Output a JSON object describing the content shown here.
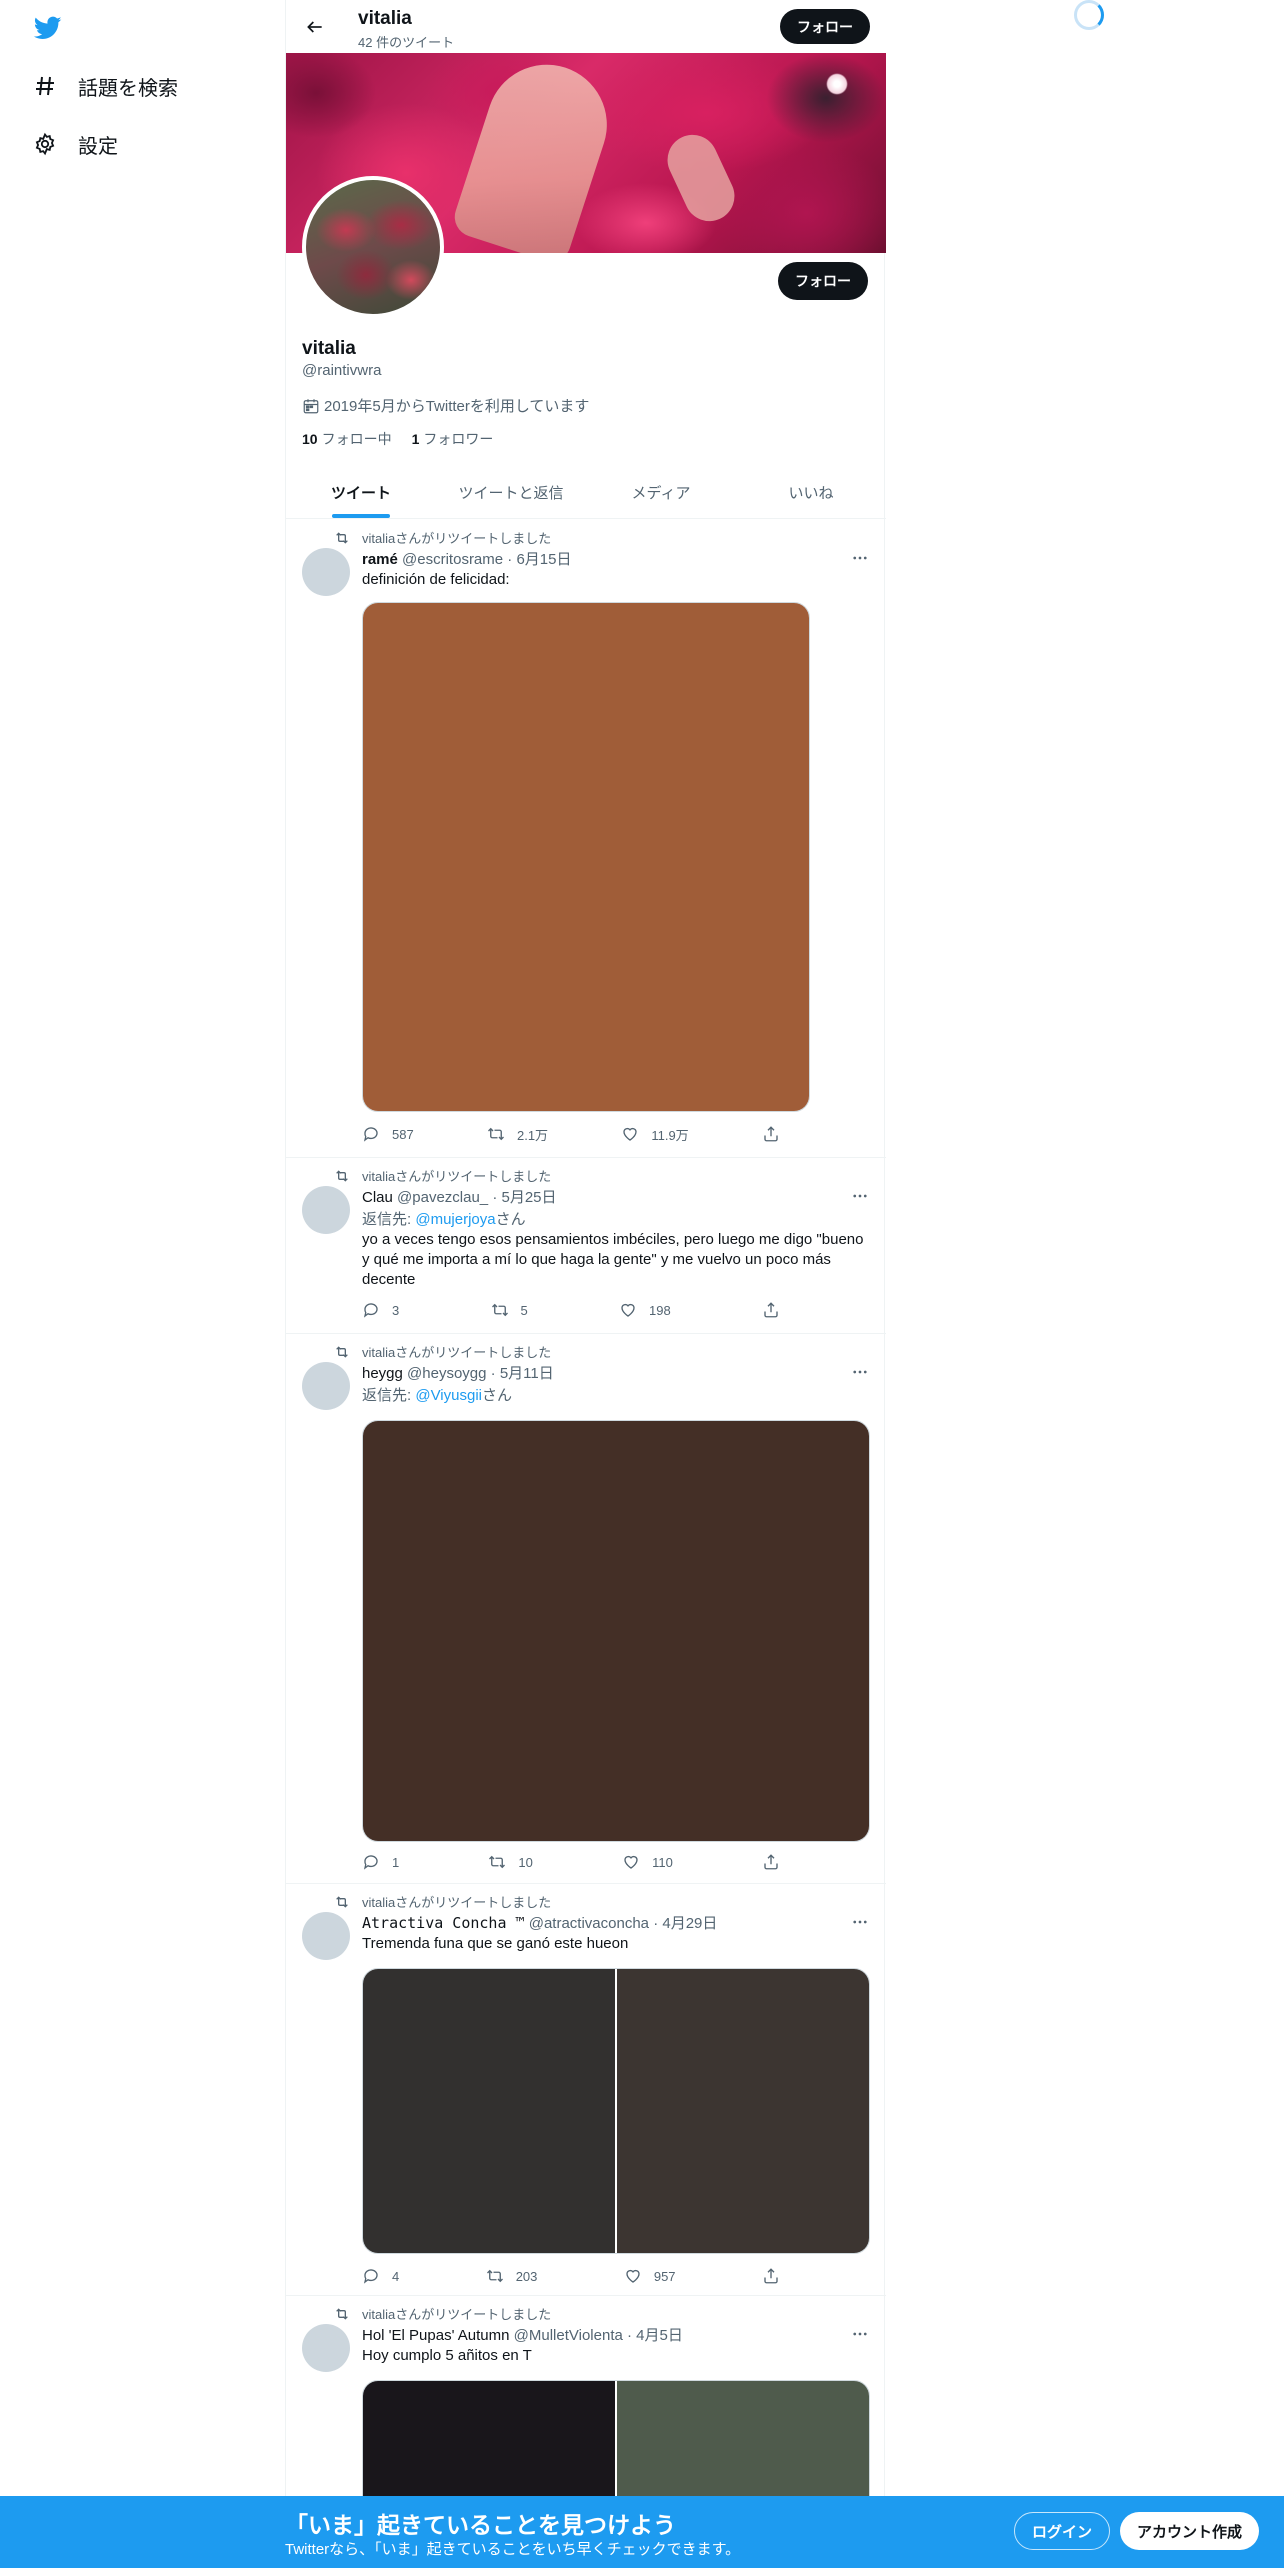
{
  "nav": {
    "logo_icon": "twitter-bird-icon",
    "items": [
      {
        "label": "話題を検索",
        "icon": "hashtag-icon"
      },
      {
        "label": "設定",
        "icon": "gear-icon"
      }
    ]
  },
  "header": {
    "name": "vitalia",
    "tweet_count": "42 件のツイート",
    "follow_label": "フォロー"
  },
  "profile": {
    "name": "vitalia",
    "handle": "@raintivwra",
    "joined": "2019年5月からTwitterを利用しています",
    "following_count": "10",
    "following_label": "フォロー中",
    "followers_count": "1",
    "followers_label": "フォロワー",
    "follow_label": "フォロー"
  },
  "tabs": [
    "ツイート",
    "ツイートと返信",
    "メディア",
    "いいね"
  ],
  "tweets": [
    {
      "retweeted_by": "vitaliaさんがリツイートしました",
      "name": "ramé",
      "handle": "@escritosrame",
      "date": "· 6月15日",
      "text": "definición de felicidad:",
      "media_colors": [
        "#a05d38"
      ],
      "replies": "587",
      "retweets": "2.1万",
      "likes": "11.9万"
    },
    {
      "retweeted_by": "vitaliaさんがリツイートしました",
      "name": "Clau",
      "handle": "@pavezclau_",
      "date": "· 5月25日",
      "reply_prefix": "返信先: ",
      "reply_to": "@mujerjoya",
      "reply_suffix": "さん",
      "text": "yo a veces tengo esos pensamientos imbéciles, pero luego me digo \"bueno y qué me importa a mí lo que haga la gente\" y me vuelvo un poco más decente",
      "replies": "3",
      "retweets": "5",
      "likes": "198"
    },
    {
      "retweeted_by": "vitaliaさんがリツイートしました",
      "name": "heygg",
      "handle": "@heysoygg",
      "date": "· 5月11日",
      "reply_prefix": "返信先: ",
      "reply_to": "@Viyusgii",
      "reply_suffix": "さん",
      "media_colors": [
        "#442f26"
      ],
      "replies": "1",
      "retweets": "10",
      "likes": "110"
    },
    {
      "retweeted_by": "vitaliaさんがリツイートしました",
      "name": "𝙰𝚝𝚛𝚊𝚌𝚝𝚒𝚟𝚊 𝙲𝚘𝚗𝚌𝚑𝚊 ™",
      "handle": "@atractivaconcha",
      "date": "· 4月29日",
      "text": "Tremenda funa que se ganó este hueon",
      "media_colors": [
        "#32302f",
        "#3c3531"
      ],
      "replies": "4",
      "retweets": "203",
      "likes": "957"
    },
    {
      "retweeted_by": "vitaliaさんがリツイートしました",
      "name": "Hol 'El Pupas' Autumn",
      "handle": "@MulletViolenta",
      "date": "· 4月5日",
      "text": "Hoy cumplo 5 añitos en T",
      "media_colors": [
        "#19161b",
        "#4f5b4c"
      ]
    }
  ],
  "bottom_bar": {
    "title": "「いま」起きていることを見つけよう",
    "subtitle": "Twitterなら、「いま」起きていることをいち早くチェックできます。",
    "login": "ログイン",
    "signup": "アカウント作成"
  }
}
